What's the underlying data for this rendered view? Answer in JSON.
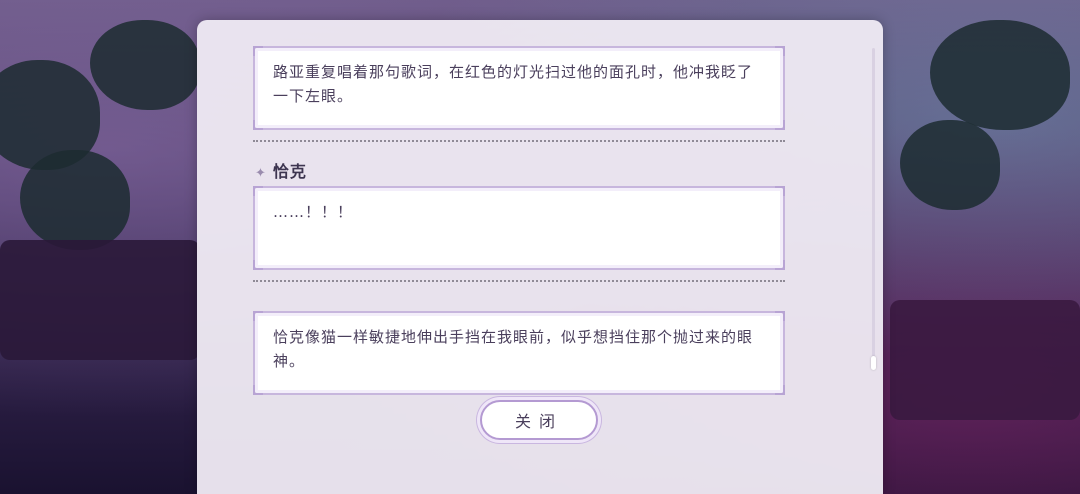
{
  "dialog": {
    "entries": [
      {
        "type": "narration",
        "text": "路亚重复唱着那句歌词，在红色的灯光扫过他的面孔时，他冲我眨了一下左眼。"
      },
      {
        "type": "speech",
        "speaker": "恰克",
        "text": "……！！！"
      },
      {
        "type": "narration",
        "text": "恰克像猫一样敏捷地伸出手挡在我眼前，似乎想挡住那个抛过来的眼神。"
      }
    ],
    "close_label": "关闭",
    "star_icon": "✦"
  },
  "colors": {
    "panel": "#eee9f2",
    "bubble_border": "#c7b6dd",
    "text": "#4a3f5c"
  }
}
